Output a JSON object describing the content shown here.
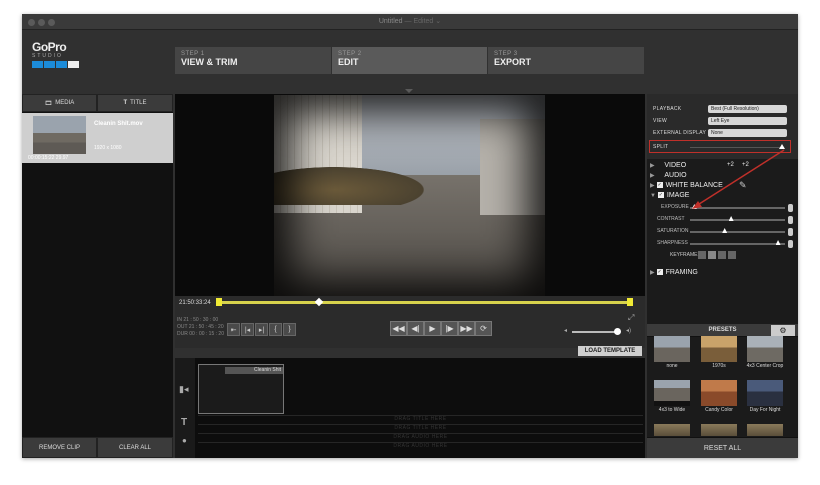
{
  "window": {
    "title": "Untitled",
    "status": "— Edited ⌄"
  },
  "logo": {
    "brand": "GoPro",
    "sub": "STUDIO"
  },
  "steps": [
    {
      "num": "STEP 1",
      "label": "VIEW & TRIM"
    },
    {
      "num": "STEP 2",
      "label": "EDIT"
    },
    {
      "num": "STEP 3",
      "label": "EXPORT"
    }
  ],
  "left_tabs": {
    "media": "MEDIA",
    "title": "TITLE"
  },
  "clip": {
    "name": "Cleanin Shit.mov",
    "resolution": "1920 x 1080",
    "duration": "00:00:15:22   29.97"
  },
  "left_buttons": {
    "remove": "REMOVE CLIP",
    "clear": "CLEAR ALL"
  },
  "viewer": {
    "timecode": "21:50:33:24",
    "in": "IN  21 : 50 : 30 : 00",
    "out": "OUT 21 : 50 : 45 : 20",
    "dur": "DUR 00 : 00 : 15 : 20",
    "load_template": "LOAD TEMPLATE"
  },
  "timeline": {
    "clip_name": "Cleanin Shit",
    "drops": [
      "DRAG TITLE HERE",
      "DRAG TITLE HERE",
      "DRAG AUDIO HERE",
      "DRAG AUDIO HERE"
    ]
  },
  "settings": {
    "playback_label": "PLAYBACK",
    "playback_value": "Best (Full Resolution)",
    "view_label": "VIEW",
    "view_value": "Left Eye",
    "external_label": "EXTERNAL DISPLAY",
    "external_value": "None",
    "split_label": "SPLIT"
  },
  "sections": {
    "video": "VIDEO",
    "video_a": "+2",
    "video_b": "+2",
    "audio": "AUDIO",
    "white_balance": "WHITE BALANCE",
    "image": "IMAGE",
    "framing": "FRAMING",
    "keyframes": "KEYFRAMES"
  },
  "sliders": [
    {
      "label": "EXPOSURE",
      "value": 0.02
    },
    {
      "label": "CONTRAST",
      "value": 0.42
    },
    {
      "label": "SATURATION",
      "value": 0.35
    },
    {
      "label": "SHARPNESS",
      "value": 0.93
    }
  ],
  "presets": {
    "title": "PRESETS",
    "items": [
      "none",
      "1970s",
      "4x3 Center Crop",
      "4x3 to Wide",
      "Candy Color",
      "Day For Night"
    ]
  },
  "reset": "RESET ALL",
  "colors": {
    "accent": "#1c8bd8",
    "highlight": "#c0302a",
    "trim": "#f0ea35"
  }
}
